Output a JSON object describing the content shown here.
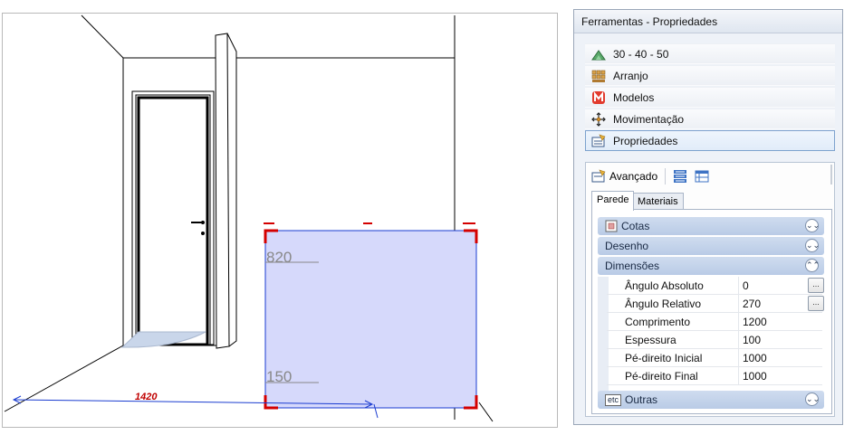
{
  "viewport": {
    "dim_vertical_top": "820",
    "dim_vertical_bottom": "150",
    "dim_horizontal": "1420",
    "colors": {
      "selection_fill": "#d6d9fb",
      "selection_edge": "#d40000",
      "dimension_blue": "#1a3cd0"
    }
  },
  "panel": {
    "title": "Ferramentas - Propriedades",
    "tools": [
      {
        "label": "30 - 40 - 50",
        "icon": "view-3d-icon"
      },
      {
        "label": "Arranjo",
        "icon": "arrangement-icon"
      },
      {
        "label": "Modelos",
        "icon": "models-m-icon"
      },
      {
        "label": "Movimentação",
        "icon": "move-arrows-icon"
      },
      {
        "label": "Propriedades",
        "icon": "properties-icon",
        "selected": true
      }
    ],
    "advanced": {
      "label": "Avançado",
      "tabs": [
        "Parede",
        "Materiais"
      ],
      "active_tab": "Parede",
      "groups": {
        "cotas": "Cotas",
        "desenho": "Desenho",
        "dimensoes": "Dimensões",
        "outras": "Outras"
      },
      "properties": [
        {
          "name": "Ângulo Absoluto",
          "value": "0",
          "button": "..."
        },
        {
          "name": "Ângulo Relativo",
          "value": "270",
          "button": "..."
        },
        {
          "name": "Comprimento",
          "value": "1200"
        },
        {
          "name": "Espessura",
          "value": "100"
        },
        {
          "name": "Pé-direito Inicial",
          "value": "1000"
        },
        {
          "name": "Pé-direito Final",
          "value": "1000"
        }
      ],
      "outras_icon_text": "etc"
    }
  }
}
